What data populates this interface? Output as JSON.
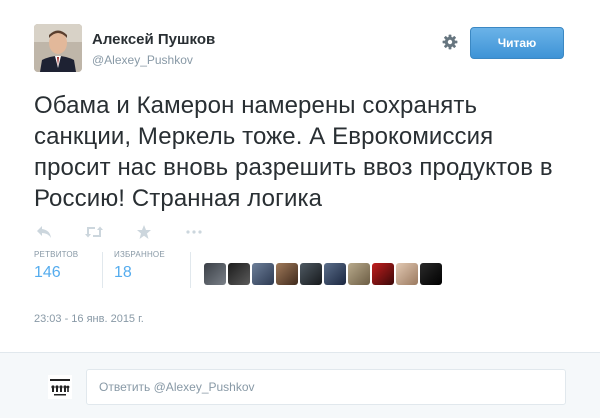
{
  "author": {
    "name": "Алексей Пушков",
    "handle": "@Alexey_Pushkov"
  },
  "header": {
    "follow_button_label": "Читаю"
  },
  "tweet": {
    "text": "Обама и Камерон намерены сохранять санкции, Меркель тоже. А Еврокомиссия просит нас вновь разрешить ввоз продуктов в Россию! Странная логика"
  },
  "stats": {
    "retweets_label": "РЕТВИТОВ",
    "retweets_count": "146",
    "favorites_label": "ИЗБРАННОЕ",
    "favorites_count": "18"
  },
  "timestamp": "23:03 - 16 янв. 2015 г.",
  "reply": {
    "placeholder": "Ответить @Alexey_Pushkov"
  },
  "icons": [
    "gear-icon",
    "reply-icon",
    "retweet-icon",
    "favorite-icon",
    "more-icon"
  ],
  "colors": {
    "accent": "#55acee",
    "button": "#3e93d6",
    "muted": "#8899a6",
    "text": "#292f33",
    "reply_bg": "#f5f8fa"
  }
}
